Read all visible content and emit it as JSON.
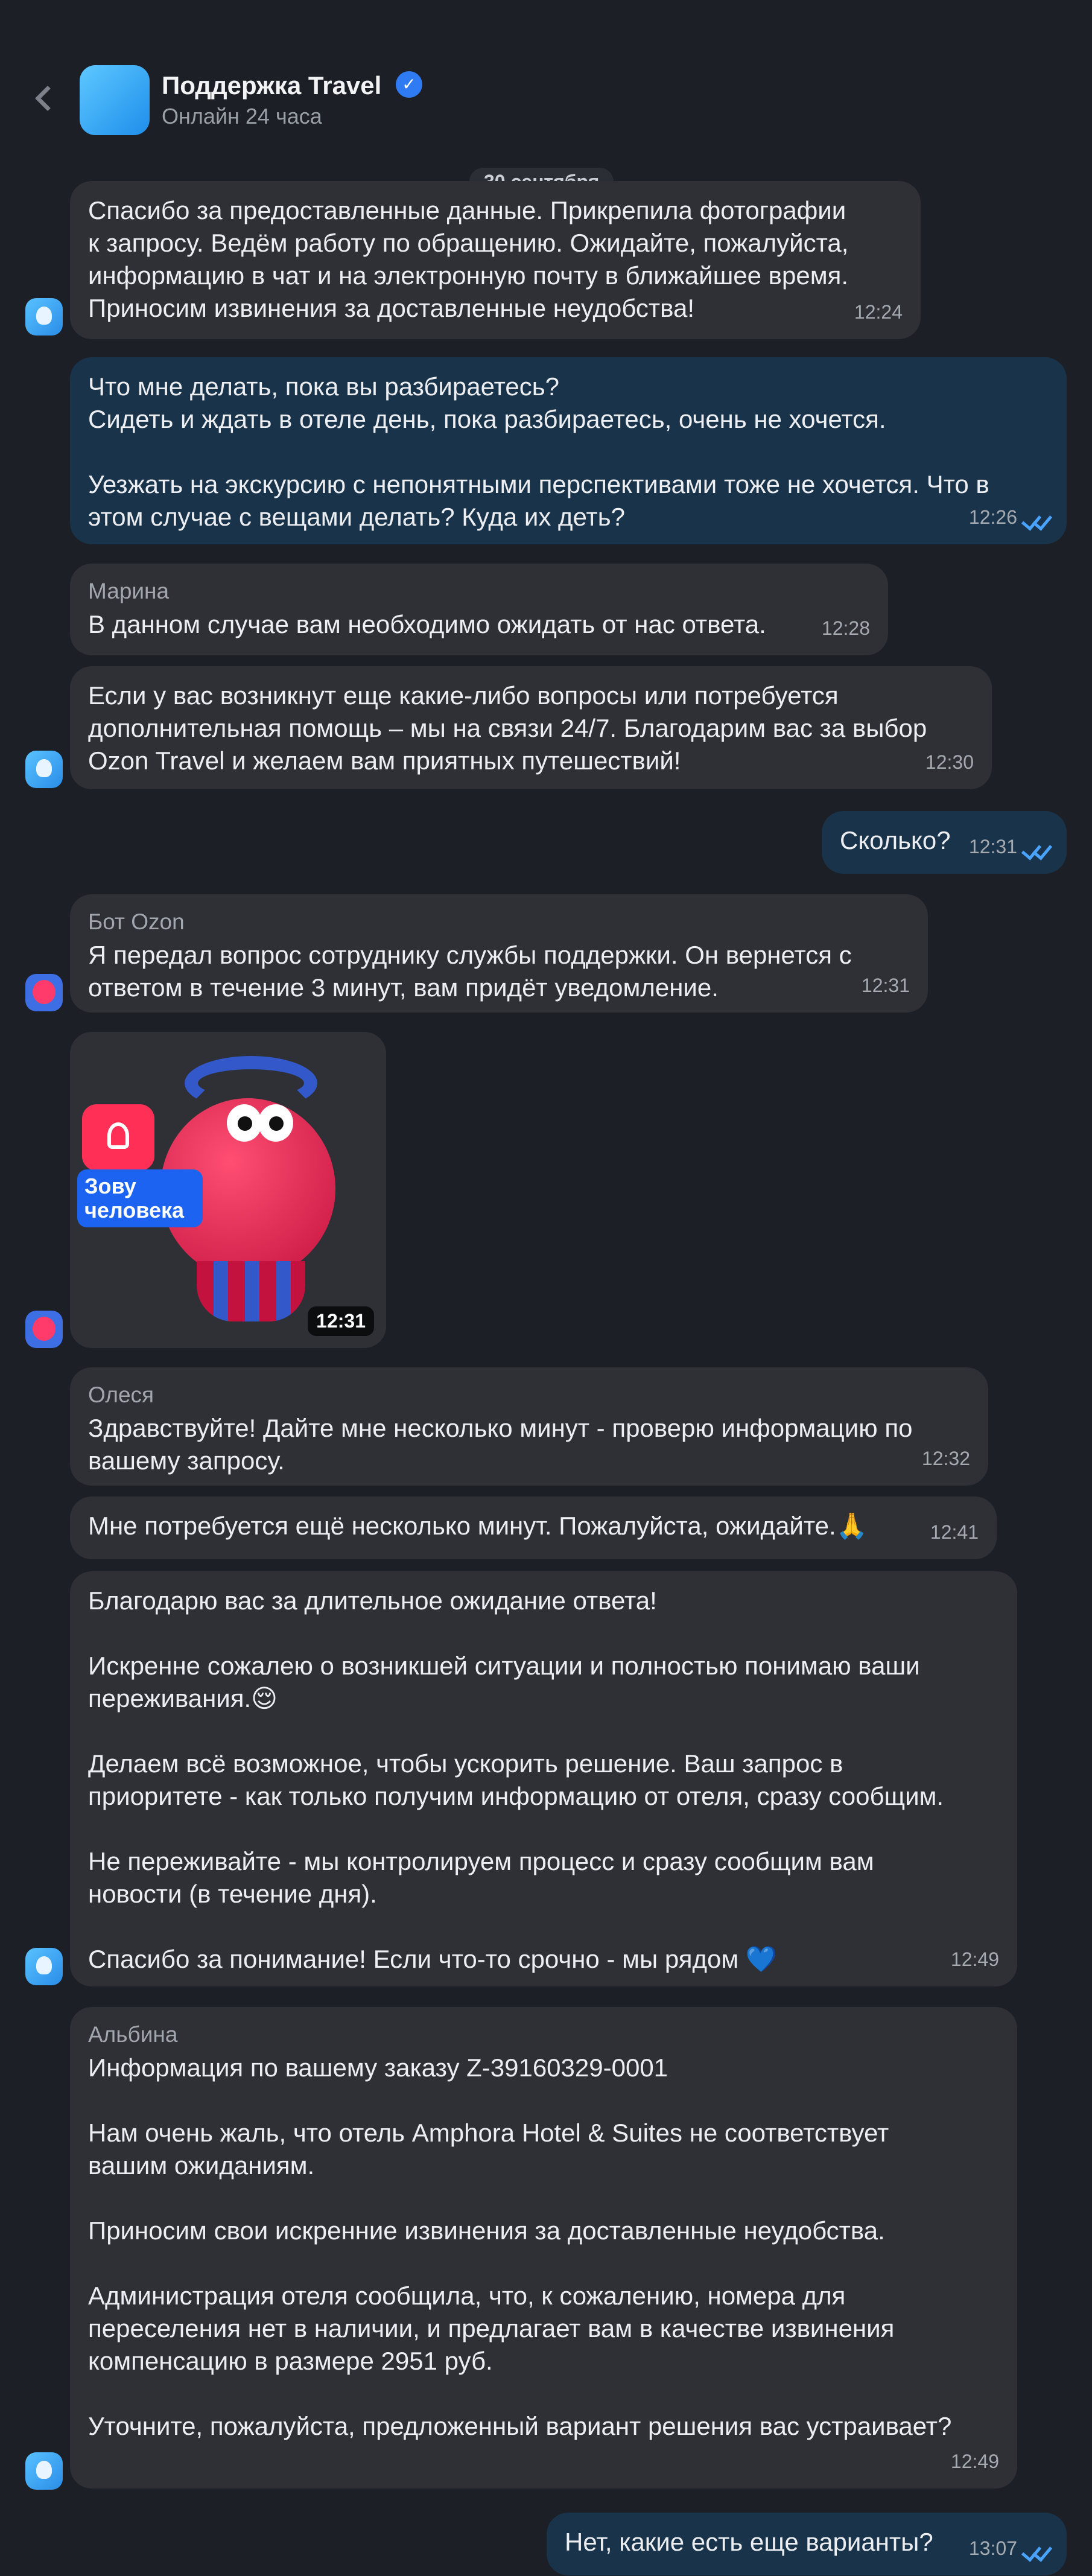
{
  "header": {
    "back_label": "",
    "title": "Поддержка Travel",
    "subtitle": "Онлайн 24 часа"
  },
  "date_separator": "30 сентября",
  "messages": [
    {
      "text": "Спасибо за предоставленные данные. Прикрепила фотографии\nк запросу. Ведём работу по обращению. Ожидайте, пожалуйста,\nинформацию в чат и на электронную почту в ближайшее время.\nПриносим извинения за доставленные неудобства!",
      "time": "12:24"
    },
    {
      "text": "Что мне делать, пока вы разбираетесь?\nСидеть и ждать в отеле день, пока разбираетесь, очень не хочется.\n\nУезжать на экскурсию с непонятными перспективами тоже не хочется. Что в\nэтом случае с вещами делать? Куда их деть?",
      "time": "12:26"
    },
    {
      "sender": "Марина",
      "text": "В данном случае вам необходимо ожидать от нас ответа.",
      "time": "12:28"
    },
    {
      "text": "Если у вас возникнут еще какие-либо вопросы или потребуется\nдополнительная помощь – мы на связи 24/7. Благодарим вас за выбор\nOzon Travel и желаем вам приятных путешествий!",
      "time": "12:30"
    },
    {
      "text": "Сколько?",
      "time": "12:31"
    },
    {
      "sender": "Бот Ozon",
      "text": "Я передал вопрос сотруднику службы поддержки. Он вернется с\nответом в течение 3 минут, вам придёт уведомление.",
      "time": "12:31"
    },
    {
      "sticker_text": "Зову\nчеловека",
      "time": "12:31"
    },
    {
      "sender": "Олеся",
      "text": "Здравствуйте! Дайте мне несколько минут - проверю информацию по\nвашему запросу.",
      "time": "12:32"
    },
    {
      "text": "Мне потребуется ещё несколько минут. Пожалуйста, ожидайте.🙏",
      "time": "12:41"
    },
    {
      "text": "Благодарю вас за длительное ожидание ответа!\n\nИскренне сожалею о возникшей ситуации и полностью понимаю ваши\nпереживания.😌\n\nДелаем всё возможное, чтобы ускорить решение. Ваш запрос в\nприоритете - как только получим информацию от отеля, сразу сообщим.\n\nНе переживайте - мы контролируем процесс и сразу сообщим вам\nновости (в течение дня).\n\nСпасибо за понимание! Если что-то срочно - мы рядом 💙",
      "time": "12:49"
    },
    {
      "sender": "Альбина",
      "text": "Информация по вашему заказу Z-39160329-0001\n\nНам очень жаль, что отель Amphora Hotel & Suites не соответствует\nвашим ожиданиям.\n\nПриносим свои искренние извинения за доставленные неудобства.\n\nАдминистрация отеля сообщила, что, к сожалению, номера для\nпереселения нет в наличии, и предлагает вам в качестве извинения\nкомпенсацию в размере 2951 руб.\n\nУточните, пожалуйста, предложенный вариант решения вас устраивает?",
      "time": "12:49"
    },
    {
      "text": "Нет, какие есть еще варианты?",
      "time": "13:07"
    }
  ],
  "colors": {
    "background": "#1c1f25",
    "incoming_bubble": "#2e3036",
    "outgoing_bubble": "#19344a",
    "read_check": "#4aa3ff"
  }
}
